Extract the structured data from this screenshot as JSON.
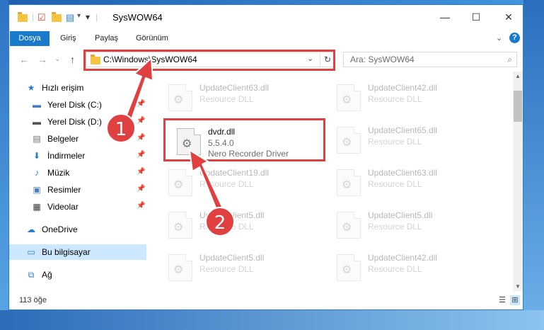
{
  "titlebar": {
    "title": "SysWOW64",
    "minimize": "—",
    "maximize": "☐",
    "close": "✕"
  },
  "ribbon": {
    "tabs": [
      "Dosya",
      "Giriş",
      "Paylaş",
      "Görünüm"
    ],
    "expand": "⌄",
    "help": "?"
  },
  "navigation": {
    "back": "←",
    "forward": "→",
    "recent": "⌄",
    "up": "↑"
  },
  "address": {
    "path": "C:\\Windows\\SysWOW64",
    "dropdown": "⌄",
    "refresh": "↻"
  },
  "search": {
    "placeholder": "Ara: SysWOW64",
    "icon": "magnifier-icon"
  },
  "sidebar": {
    "items": [
      {
        "label": "Hızlı erişim",
        "icon": "star-icon",
        "glyph": "★",
        "color": "#2b7bd0",
        "pinned": false
      },
      {
        "label": "Yerel Disk (C:)",
        "icon": "drive-icon",
        "glyph": "▬",
        "color": "#4a7fbf",
        "pinned": true
      },
      {
        "label": "Yerel Disk (D:)",
        "icon": "drive-icon",
        "glyph": "▬",
        "color": "#555555",
        "pinned": true
      },
      {
        "label": "Belgeler",
        "icon": "documents-icon",
        "glyph": "▤",
        "color": "#6b6b6b",
        "pinned": true
      },
      {
        "label": "İndirmeler",
        "icon": "download-icon",
        "glyph": "⬇",
        "color": "#2b7bd0",
        "pinned": true
      },
      {
        "label": "Müzik",
        "icon": "music-icon",
        "glyph": "♪",
        "color": "#2b7bd0",
        "pinned": true
      },
      {
        "label": "Resimler",
        "icon": "pictures-icon",
        "glyph": "▣",
        "color": "#4a7fbf",
        "pinned": true
      },
      {
        "label": "Videolar",
        "icon": "videos-icon",
        "glyph": "▦",
        "color": "#333333",
        "pinned": true
      },
      {
        "label": "OneDrive",
        "icon": "cloud-icon",
        "glyph": "☁",
        "color": "#2b7bd0",
        "pinned": false
      },
      {
        "label": "Bu bilgisayar",
        "icon": "computer-icon",
        "glyph": "▭",
        "color": "#2b7bd0",
        "pinned": false,
        "selected": true
      },
      {
        "label": "Ağ",
        "icon": "network-icon",
        "glyph": "⧉",
        "color": "#2b7bd0",
        "pinned": false
      }
    ]
  },
  "files": {
    "highlighted": {
      "name": "dvdr.dll",
      "version": "5.5.4.0",
      "description": "Nero Recorder Driver"
    },
    "background": [
      {
        "name": "UpdateClient63.dll",
        "type": "Resource DLL"
      },
      {
        "name": "UpdateClient42.dll",
        "type": "Resource DLL"
      },
      {
        "name": "UpdateClient65.dll",
        "type": "Resource DLL"
      },
      {
        "name": "UpdateClient19.dll",
        "type": "Resource DLL"
      },
      {
        "name": "UpdateClient63.dll",
        "type": "Resource DLL"
      },
      {
        "name": "UpdateClient5.dll",
        "type": "Resource DLL"
      },
      {
        "name": "UpdateClient5.dll",
        "type": "Resource DLL"
      },
      {
        "name": "UpdateClient5.dll",
        "type": "Resource DLL"
      },
      {
        "name": "UpdateClient42.dll",
        "type": "Resource DLL"
      }
    ]
  },
  "status": {
    "count": "113 öğe",
    "view_details": "☰",
    "view_tiles": "⊞"
  },
  "callouts": {
    "one": "1",
    "two": "2",
    "color": "#e14040"
  }
}
